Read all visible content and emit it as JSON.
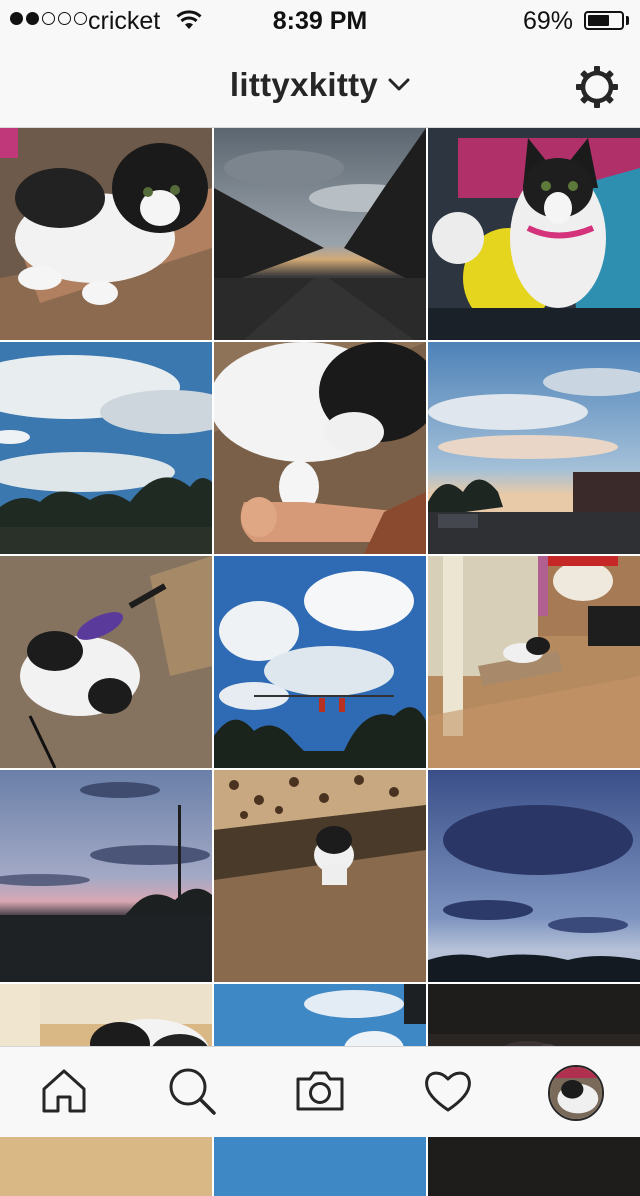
{
  "status_bar": {
    "carrier": "cricket",
    "time": "8:39 PM",
    "battery_percent": "69%",
    "battery_level": 0.69,
    "signal_bars_filled": 2,
    "signal_bars_total": 5
  },
  "header": {
    "username": "littyxkitty",
    "dropdown_icon": "chevron-down-icon",
    "settings_icon": "gear-icon"
  },
  "grid": {
    "photos": [
      {
        "subject": "black and white kitten on scratcher"
      },
      {
        "subject": "road at dusk with cloudy sky"
      },
      {
        "subject": "kitten with pink collar on yellow blanket"
      },
      {
        "subject": "blue sky with clouds over trees"
      },
      {
        "subject": "kitten paw touching finger"
      },
      {
        "subject": "sky over parking lot"
      },
      {
        "subject": "kitten playing with feather toy"
      },
      {
        "subject": "blue sky with cumulus clouds and traffic light"
      },
      {
        "subject": "kitten lying in bathroom"
      },
      {
        "subject": "purple dusk sky over field"
      },
      {
        "subject": "kitten under leopard print bed"
      },
      {
        "subject": "blue evening sky with dark clouds"
      },
      {
        "subject": "kitten eating from bowl"
      },
      {
        "subject": "blue sky with clouds"
      },
      {
        "subject": "dark photo of kitten"
      }
    ]
  },
  "tab_bar": {
    "tabs": [
      {
        "name": "home",
        "icon": "home-icon"
      },
      {
        "name": "search",
        "icon": "search-icon"
      },
      {
        "name": "camera",
        "icon": "camera-icon"
      },
      {
        "name": "activity",
        "icon": "heart-icon"
      },
      {
        "name": "profile",
        "icon": "profile-avatar"
      }
    ]
  },
  "colors": {
    "bar_background": "#f8f8f8",
    "text": "#262626",
    "divider": "#dadada"
  }
}
